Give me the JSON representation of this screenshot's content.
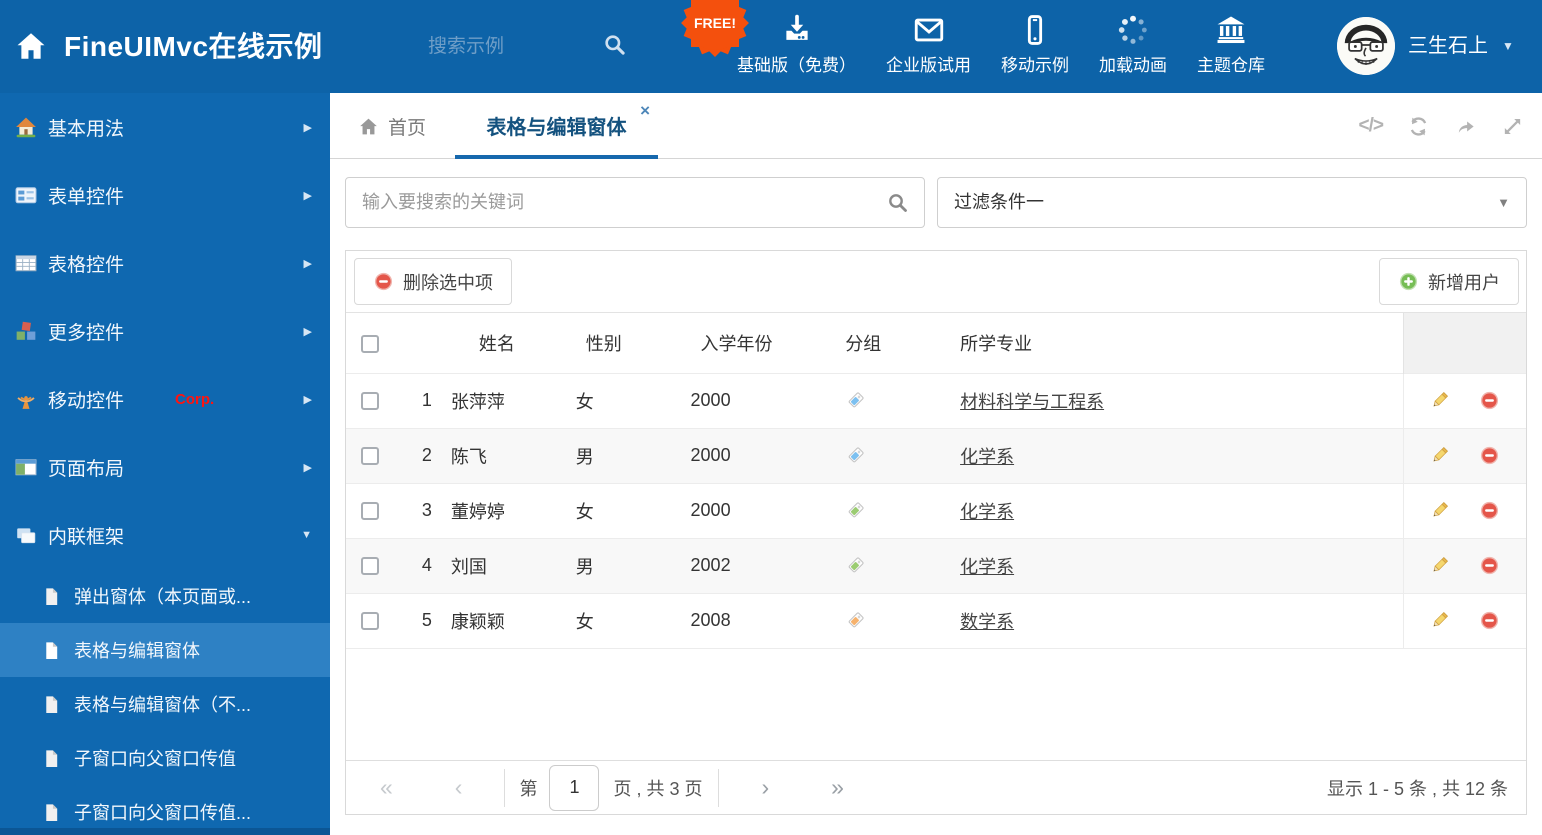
{
  "header": {
    "title": "FineUIMvc在线示例",
    "search_placeholder": "搜索示例",
    "free_badge": "FREE!",
    "nav": [
      {
        "label": "基础版（免费）",
        "icon": "download-icon"
      },
      {
        "label": "企业版试用",
        "icon": "envelope-icon"
      },
      {
        "label": "移动示例",
        "icon": "mobile-icon"
      },
      {
        "label": "加载动画",
        "icon": "spinner-icon"
      },
      {
        "label": "主题仓库",
        "icon": "bank-icon"
      }
    ],
    "user_name": "三生石上"
  },
  "sidebar": {
    "items": [
      {
        "label": "基本用法",
        "icon": "home-icon"
      },
      {
        "label": "表单控件",
        "icon": "form-icon"
      },
      {
        "label": "表格控件",
        "icon": "table-icon"
      },
      {
        "label": "更多控件",
        "icon": "cubes-icon"
      },
      {
        "label": "移动控件",
        "badge": "Corp.",
        "icon": "antenna-icon"
      },
      {
        "label": "页面布局",
        "icon": "layout-icon"
      },
      {
        "label": "内联框架",
        "icon": "frames-icon"
      }
    ],
    "subitems": [
      {
        "label": "弹出窗体（本页面或..."
      },
      {
        "label": "表格与编辑窗体"
      },
      {
        "label": "表格与编辑窗体（不..."
      },
      {
        "label": "子窗口向父窗口传值"
      },
      {
        "label": "子窗口向父窗口传值..."
      }
    ]
  },
  "tabbar": {
    "home_tab": "首页",
    "active_tab": "表格与编辑窗体",
    "close_glyph": "×",
    "code_icon_glyph": "</>"
  },
  "filters": {
    "search_placeholder": "输入要搜索的关键词",
    "filter_value": "过滤条件一"
  },
  "toolbar": {
    "delete_label": "删除选中项",
    "add_label": "新增用户"
  },
  "grid": {
    "columns": {
      "name": "姓名",
      "gender": "性别",
      "year": "入学年份",
      "group": "分组",
      "major": "所学专业"
    },
    "rows": [
      {
        "num": "1",
        "name": "张萍萍",
        "gender": "女",
        "year": "2000",
        "tag_color": "#7cc0f0",
        "major": "材料科学与工程系"
      },
      {
        "num": "2",
        "name": "陈飞",
        "gender": "男",
        "year": "2000",
        "tag_color": "#7cc0f0",
        "major": "化学系"
      },
      {
        "num": "3",
        "name": "董婷婷",
        "gender": "女",
        "year": "2000",
        "tag_color": "#9bcc72",
        "major": "化学系"
      },
      {
        "num": "4",
        "name": "刘国",
        "gender": "男",
        "year": "2002",
        "tag_color": "#9bcc72",
        "major": "化学系"
      },
      {
        "num": "5",
        "name": "康颖颖",
        "gender": "女",
        "year": "2008",
        "tag_color": "#f6b26d",
        "major": "数学系"
      }
    ]
  },
  "pagination": {
    "first_glyph": "«",
    "prev_glyph": "‹",
    "next_glyph": "›",
    "last_glyph": "»",
    "page_prefix": "第",
    "current_page": "1",
    "page_suffix": "页 , 共 3 页",
    "summary": "显示 1 - 5 条 , 共 12 条"
  },
  "colors": {
    "header_blue": "#0d63a8",
    "sidebar_blue": "#0f68b0",
    "selected_item_blue": "#2e81c4",
    "accent_blue": "#1668ad",
    "free_orange": "#f4500d",
    "corp_red": "#ff1410",
    "delete_red": "#e4564a",
    "add_green": "#76bd55"
  }
}
